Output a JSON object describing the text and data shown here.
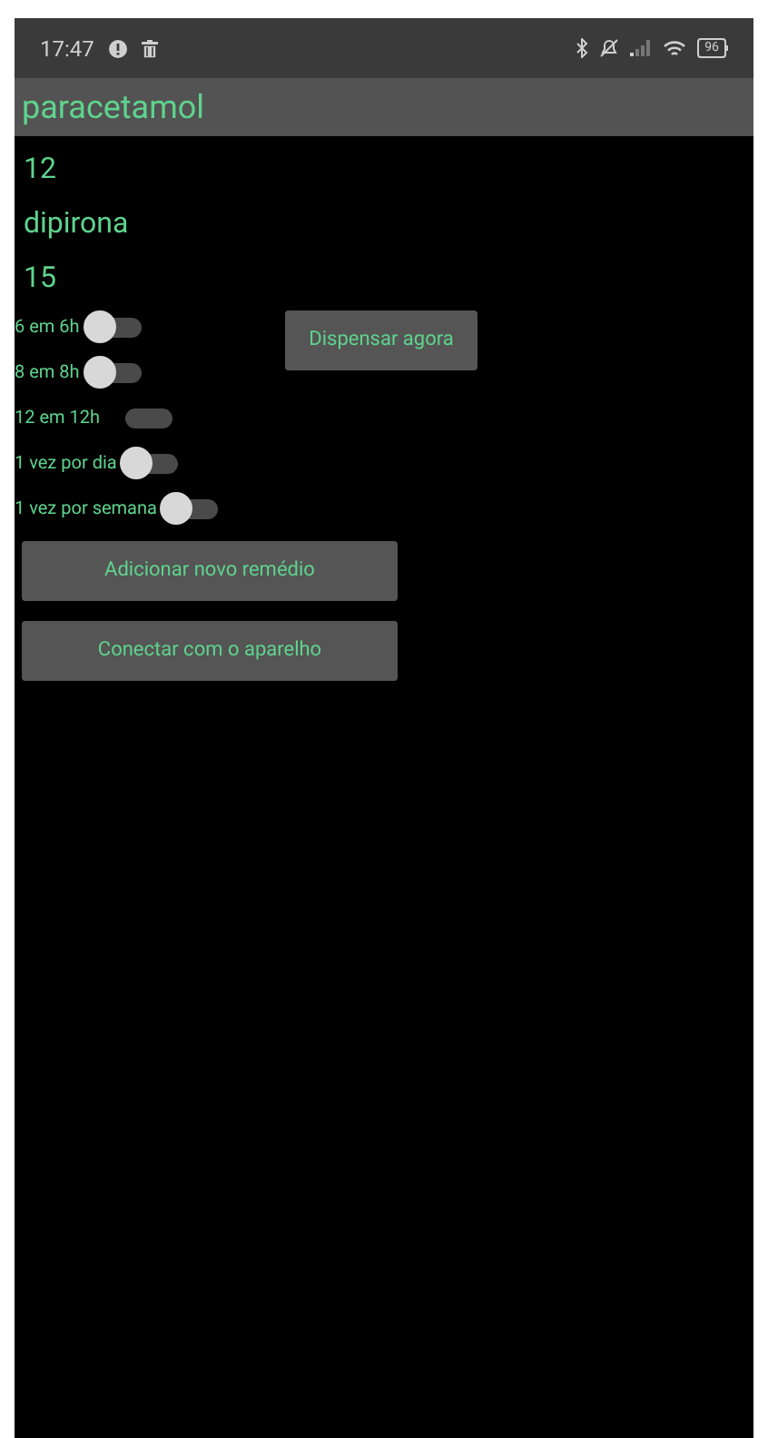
{
  "status_bar": {
    "time": "17:47",
    "battery": "96"
  },
  "title": "paracetamol",
  "fields": [
    {
      "value": "12"
    },
    {
      "value": "dipirona"
    },
    {
      "value": "15"
    }
  ],
  "schedules": [
    {
      "label": "6 em 6h",
      "on": false,
      "thumb": true
    },
    {
      "label": "8 em 8h",
      "on": false,
      "thumb": true
    },
    {
      "label": "12 em 12h",
      "on": false,
      "thumb": false
    },
    {
      "label": "1 vez por dia",
      "on": false,
      "thumb": true
    },
    {
      "label": "1 vez por semana",
      "on": false,
      "thumb": true
    }
  ],
  "dispense_button": "Dispensar agora",
  "buttons": [
    "Adicionar novo remédio",
    "Conectar com o aparelho"
  ]
}
